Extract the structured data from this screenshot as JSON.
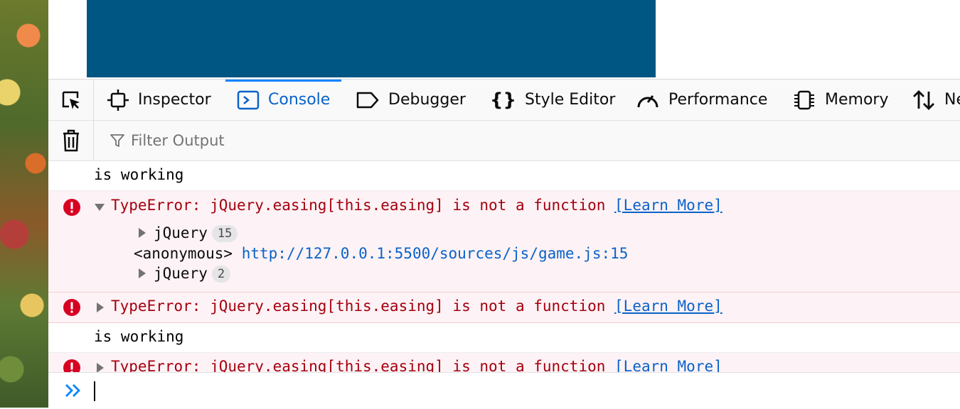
{
  "toolbar": {
    "tabs": [
      {
        "label": "Inspector",
        "icon": "inspector-icon"
      },
      {
        "label": "Console",
        "icon": "console-icon",
        "active": true
      },
      {
        "label": "Debugger",
        "icon": "debugger-icon"
      },
      {
        "label": "Style Editor",
        "icon": "style-editor-icon"
      },
      {
        "label": "Performance",
        "icon": "performance-icon"
      },
      {
        "label": "Memory",
        "icon": "memory-icon"
      },
      {
        "label": "Ne",
        "icon": "network-icon"
      }
    ]
  },
  "filter": {
    "placeholder": "Filter Output"
  },
  "console": {
    "messages": [
      {
        "type": "log",
        "text": "is working"
      },
      {
        "type": "error",
        "expanded": true,
        "text": "TypeError: jQuery.easing[this.easing] is not a function",
        "learn_more": "[Learn More]",
        "trace": [
          {
            "fn": "jQuery",
            "count": "15"
          },
          {
            "fn": "<anonymous>",
            "location": "http://127.0.0.1:5500/sources/js/game.js:15"
          },
          {
            "fn": "jQuery",
            "count": "2"
          }
        ]
      },
      {
        "type": "error",
        "expanded": false,
        "text": "TypeError: jQuery.easing[this.easing] is not a function",
        "learn_more": "[Learn More]"
      },
      {
        "type": "log",
        "text": "is working"
      },
      {
        "type": "error",
        "expanded": false,
        "text": "TypeError: jQuery.easing[this.easing] is not a function",
        "learn_more": "[Learn More]"
      }
    ]
  },
  "input": {
    "value": ""
  },
  "colors": {
    "accent": "#0a84ff",
    "error_text": "#a4000f",
    "error_bg": "#fdf2f5",
    "page_banner": "#005682"
  }
}
